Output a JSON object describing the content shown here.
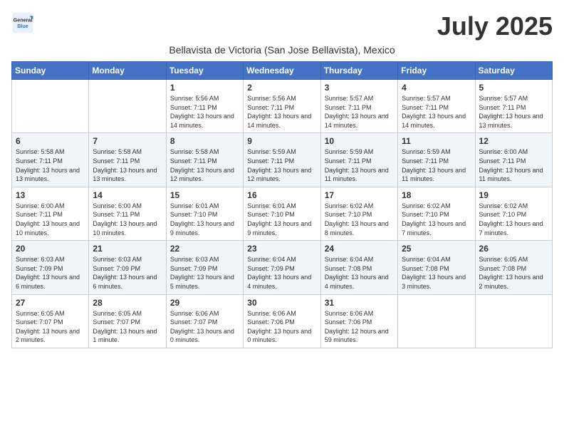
{
  "logo": {
    "line1": "General",
    "line2": "Blue"
  },
  "title": "July 2025",
  "subtitle": "Bellavista de Victoria (San Jose Bellavista), Mexico",
  "header": {
    "days": [
      "Sunday",
      "Monday",
      "Tuesday",
      "Wednesday",
      "Thursday",
      "Friday",
      "Saturday"
    ]
  },
  "weeks": [
    {
      "days": [
        {
          "num": "",
          "info": ""
        },
        {
          "num": "",
          "info": ""
        },
        {
          "num": "1",
          "info": "Sunrise: 5:56 AM\nSunset: 7:11 PM\nDaylight: 13 hours and 14 minutes."
        },
        {
          "num": "2",
          "info": "Sunrise: 5:56 AM\nSunset: 7:11 PM\nDaylight: 13 hours and 14 minutes."
        },
        {
          "num": "3",
          "info": "Sunrise: 5:57 AM\nSunset: 7:11 PM\nDaylight: 13 hours and 14 minutes."
        },
        {
          "num": "4",
          "info": "Sunrise: 5:57 AM\nSunset: 7:11 PM\nDaylight: 13 hours and 14 minutes."
        },
        {
          "num": "5",
          "info": "Sunrise: 5:57 AM\nSunset: 7:11 PM\nDaylight: 13 hours and 13 minutes."
        }
      ]
    },
    {
      "days": [
        {
          "num": "6",
          "info": "Sunrise: 5:58 AM\nSunset: 7:11 PM\nDaylight: 13 hours and 13 minutes."
        },
        {
          "num": "7",
          "info": "Sunrise: 5:58 AM\nSunset: 7:11 PM\nDaylight: 13 hours and 13 minutes."
        },
        {
          "num": "8",
          "info": "Sunrise: 5:58 AM\nSunset: 7:11 PM\nDaylight: 13 hours and 12 minutes."
        },
        {
          "num": "9",
          "info": "Sunrise: 5:59 AM\nSunset: 7:11 PM\nDaylight: 13 hours and 12 minutes."
        },
        {
          "num": "10",
          "info": "Sunrise: 5:59 AM\nSunset: 7:11 PM\nDaylight: 13 hours and 11 minutes."
        },
        {
          "num": "11",
          "info": "Sunrise: 5:59 AM\nSunset: 7:11 PM\nDaylight: 13 hours and 11 minutes."
        },
        {
          "num": "12",
          "info": "Sunrise: 6:00 AM\nSunset: 7:11 PM\nDaylight: 13 hours and 11 minutes."
        }
      ]
    },
    {
      "days": [
        {
          "num": "13",
          "info": "Sunrise: 6:00 AM\nSunset: 7:11 PM\nDaylight: 13 hours and 10 minutes."
        },
        {
          "num": "14",
          "info": "Sunrise: 6:00 AM\nSunset: 7:11 PM\nDaylight: 13 hours and 10 minutes."
        },
        {
          "num": "15",
          "info": "Sunrise: 6:01 AM\nSunset: 7:10 PM\nDaylight: 13 hours and 9 minutes."
        },
        {
          "num": "16",
          "info": "Sunrise: 6:01 AM\nSunset: 7:10 PM\nDaylight: 13 hours and 9 minutes."
        },
        {
          "num": "17",
          "info": "Sunrise: 6:02 AM\nSunset: 7:10 PM\nDaylight: 13 hours and 8 minutes."
        },
        {
          "num": "18",
          "info": "Sunrise: 6:02 AM\nSunset: 7:10 PM\nDaylight: 13 hours and 7 minutes."
        },
        {
          "num": "19",
          "info": "Sunrise: 6:02 AM\nSunset: 7:10 PM\nDaylight: 13 hours and 7 minutes."
        }
      ]
    },
    {
      "days": [
        {
          "num": "20",
          "info": "Sunrise: 6:03 AM\nSunset: 7:09 PM\nDaylight: 13 hours and 6 minutes."
        },
        {
          "num": "21",
          "info": "Sunrise: 6:03 AM\nSunset: 7:09 PM\nDaylight: 13 hours and 6 minutes."
        },
        {
          "num": "22",
          "info": "Sunrise: 6:03 AM\nSunset: 7:09 PM\nDaylight: 13 hours and 5 minutes."
        },
        {
          "num": "23",
          "info": "Sunrise: 6:04 AM\nSunset: 7:09 PM\nDaylight: 13 hours and 4 minutes."
        },
        {
          "num": "24",
          "info": "Sunrise: 6:04 AM\nSunset: 7:08 PM\nDaylight: 13 hours and 4 minutes."
        },
        {
          "num": "25",
          "info": "Sunrise: 6:04 AM\nSunset: 7:08 PM\nDaylight: 13 hours and 3 minutes."
        },
        {
          "num": "26",
          "info": "Sunrise: 6:05 AM\nSunset: 7:08 PM\nDaylight: 13 hours and 2 minutes."
        }
      ]
    },
    {
      "days": [
        {
          "num": "27",
          "info": "Sunrise: 6:05 AM\nSunset: 7:07 PM\nDaylight: 13 hours and 2 minutes."
        },
        {
          "num": "28",
          "info": "Sunrise: 6:05 AM\nSunset: 7:07 PM\nDaylight: 13 hours and 1 minute."
        },
        {
          "num": "29",
          "info": "Sunrise: 6:06 AM\nSunset: 7:07 PM\nDaylight: 13 hours and 0 minutes."
        },
        {
          "num": "30",
          "info": "Sunrise: 6:06 AM\nSunset: 7:06 PM\nDaylight: 13 hours and 0 minutes."
        },
        {
          "num": "31",
          "info": "Sunrise: 6:06 AM\nSunset: 7:06 PM\nDaylight: 12 hours and 59 minutes."
        },
        {
          "num": "",
          "info": ""
        },
        {
          "num": "",
          "info": ""
        }
      ]
    }
  ]
}
